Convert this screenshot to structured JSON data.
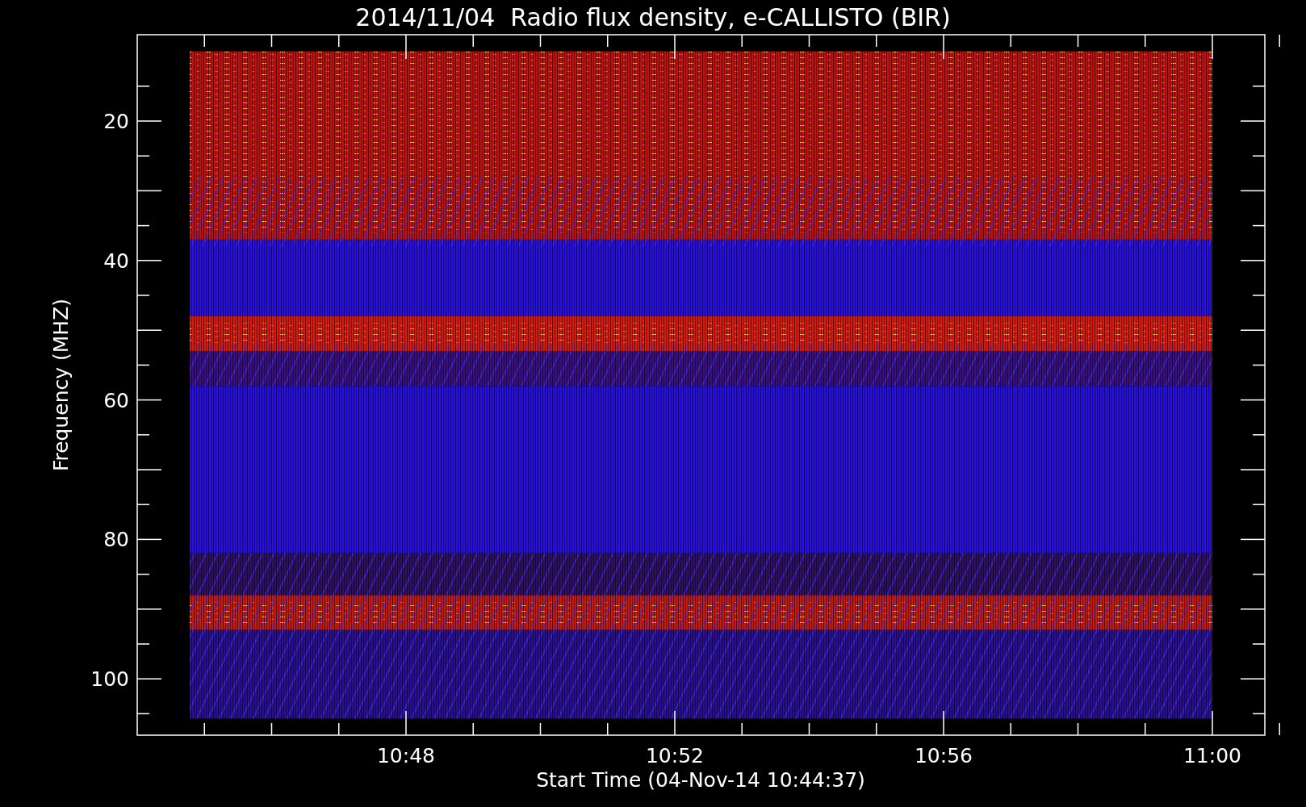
{
  "plot": {
    "title": "2014/11/04  Radio flux density, e-CALLISTO (BIR)",
    "y_axis_label": "Frequency (MHZ)",
    "x_axis_label": "Start Time (04-Nov-14 10:44:37)",
    "y_tick_labels": [
      "20",
      "40",
      "60",
      "80",
      "100"
    ],
    "x_tick_labels": [
      "10:48",
      "10:52",
      "10:56",
      "11:00"
    ]
  }
}
